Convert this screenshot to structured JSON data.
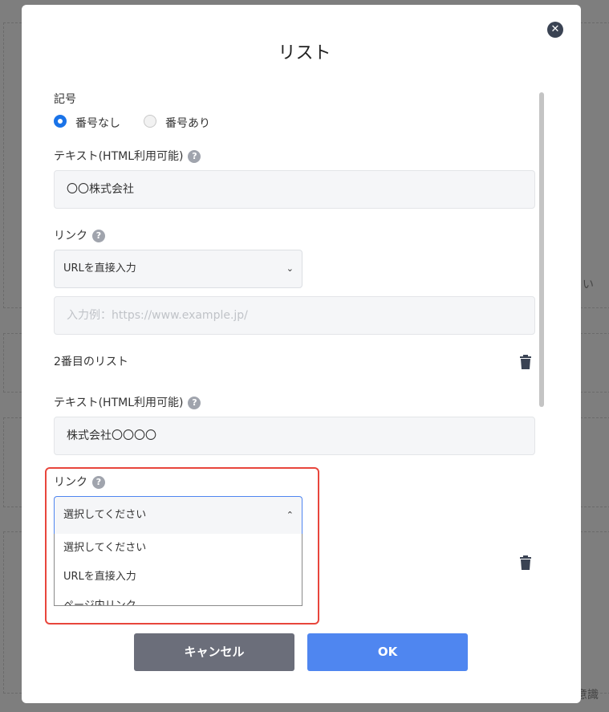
{
  "background": {
    "right_text_1": "い",
    "right_text_2": "意識"
  },
  "modal": {
    "title": "リスト",
    "close_icon": "close-icon",
    "symbol_label": "記号",
    "radio_options": [
      "番号なし",
      "番号あり"
    ],
    "selected_radio": "番号なし",
    "items": [
      {
        "text_label": "テキスト(HTML利用可能)",
        "text_value": "〇〇株式会社",
        "link_label": "リンク",
        "link_select": "URLを直接入力",
        "url_placeholder": "入力例：https://www.example.jp/"
      },
      {
        "heading": "2番目のリスト",
        "text_label": "テキスト(HTML利用可能)",
        "text_value": "株式会社〇〇〇〇",
        "link_label": "リンク",
        "link_select": "選択してください",
        "dropdown_options": [
          "選択してください",
          "URLを直接入力",
          "ページ内リンク"
        ]
      }
    ],
    "cancel_label": "キャンセル",
    "ok_label": "OK"
  },
  "colors": {
    "accent": "#1a73e8",
    "ok_button": "#4f86f0",
    "cancel_button": "#6b6e7a",
    "highlight": "#e8463c"
  }
}
